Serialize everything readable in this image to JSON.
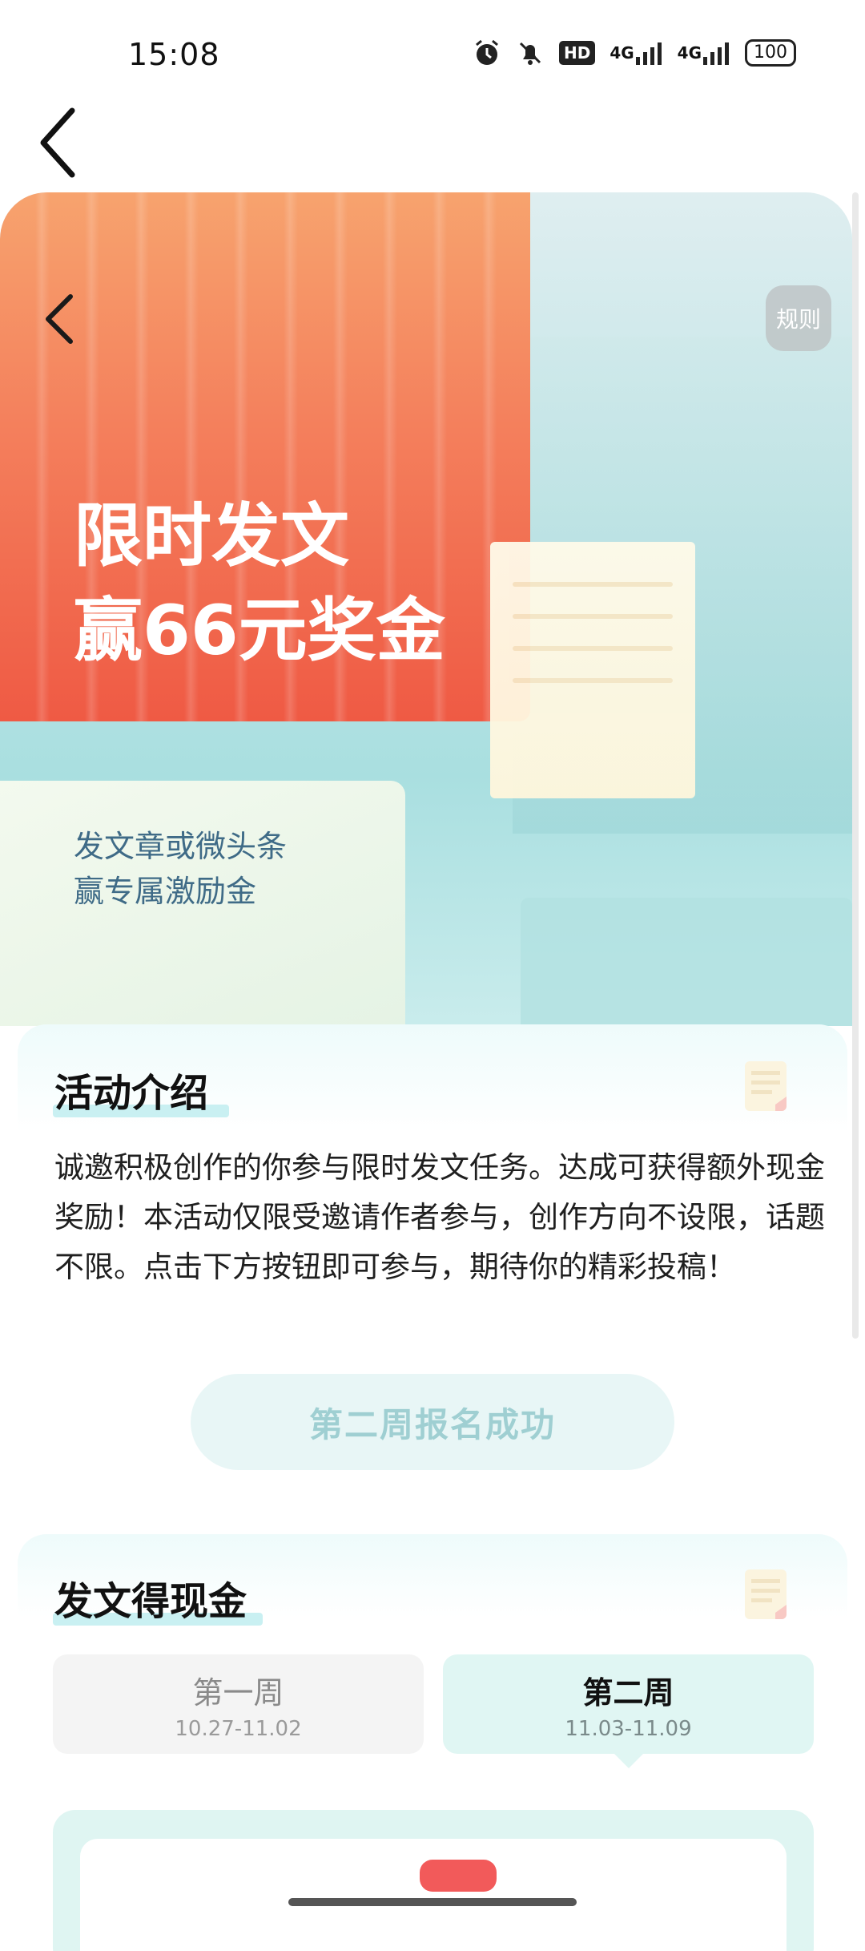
{
  "status_bar": {
    "time": "15:08",
    "hd_label": "HD",
    "signal1": "4G",
    "signal2": "4G",
    "battery": "100"
  },
  "banner": {
    "title_line1": "限时发文",
    "title_line2": "赢66元奖金",
    "subtitle_line1": "发文章或微头条",
    "subtitle_line2": "赢专属激励金",
    "rules_label": "规则"
  },
  "intro": {
    "title": "活动介绍",
    "body": "诚邀积极创作的你参与限时发文任务。达成可获得额外现金奖励！本活动仅限受邀请作者参与，创作方向不设限，话题不限。点击下方按钮即可参与，期待你的精彩投稿！",
    "status_button": "第二周报名成功"
  },
  "cash": {
    "title": "发文得现金",
    "tabs": [
      {
        "name": "第一周",
        "dates": "10.27-11.02"
      },
      {
        "name": "第二周",
        "dates": "11.03-11.09"
      }
    ]
  },
  "colors": {
    "accent_teal": "#e0f6f3",
    "banner_orange": "#f47f5c",
    "success_text": "#9fcfd2"
  }
}
